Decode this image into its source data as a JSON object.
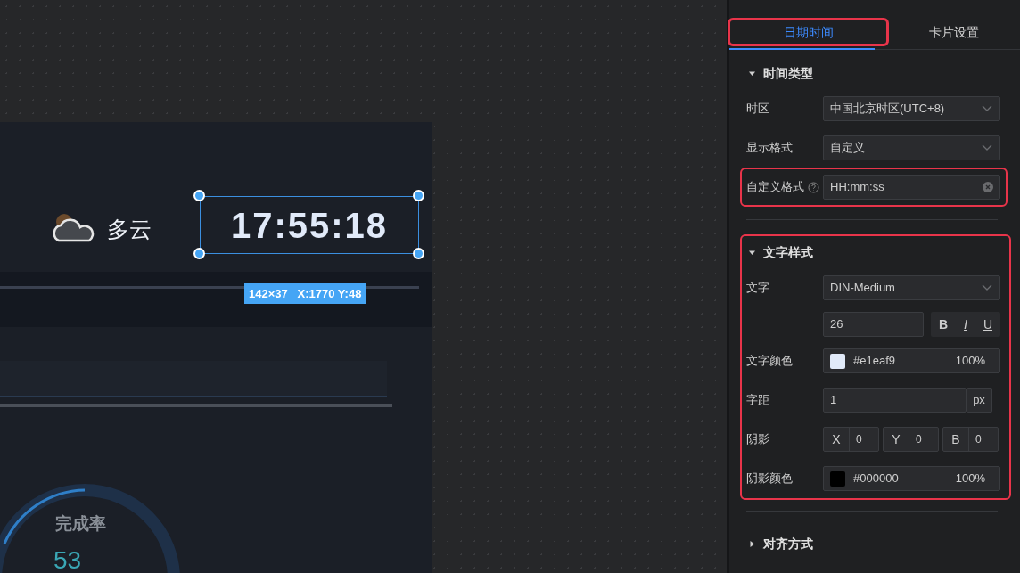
{
  "canvas": {
    "weather": {
      "label": "多云"
    },
    "clock": {
      "time": "17:55:18",
      "selected": true,
      "size_label": "142×37   X:1770 Y:48"
    },
    "gauge": {
      "title": "完成率",
      "value": "53"
    }
  },
  "panel": {
    "tabs": [
      {
        "label": "日期时间",
        "selected": true,
        "highlighted": true
      },
      {
        "label": "卡片设置",
        "selected": false,
        "highlighted": false
      }
    ],
    "sections": [
      {
        "title": "时间类型",
        "expanded": true,
        "highlighted": false,
        "fields": [
          {
            "kind": "select",
            "label": "时区",
            "value": "中国北京时区(UTC+8)",
            "highlighted": false
          },
          {
            "kind": "select",
            "label": "显示格式",
            "value": "自定义",
            "highlighted": false
          },
          {
            "kind": "clearable",
            "label": "自定义格式",
            "value": "HH:mm:ss",
            "highlighted": true
          }
        ]
      },
      {
        "title": "文字样式",
        "expanded": true,
        "highlighted": true,
        "fields": [
          {
            "kind": "select",
            "label": "文字",
            "value": "DIN-Medium",
            "highlighted": false
          },
          {
            "kind": "size",
            "value": "26",
            "styles": [
              "B",
              "I",
              "U"
            ],
            "highlighted": false
          },
          {
            "kind": "color",
            "label": "文字颜色",
            "value": "#e1eaf9",
            "opacity": "100%",
            "highlighted": false
          },
          {
            "kind": "unit",
            "label": "字距",
            "value": "1",
            "unit": "px",
            "highlighted": false
          },
          {
            "kind": "triple",
            "label": "阴影",
            "items": [
              {
                "axis": "X",
                "value": "0"
              },
              {
                "axis": "Y",
                "value": "0"
              },
              {
                "axis": "B",
                "value": "0"
              }
            ],
            "highlighted": false
          },
          {
            "kind": "color",
            "label": "阴影颜色",
            "value": "#000000",
            "opacity": "100%",
            "highlighted": false
          }
        ]
      },
      {
        "title": "对齐方式",
        "expanded": false,
        "highlighted": false
      }
    ]
  }
}
